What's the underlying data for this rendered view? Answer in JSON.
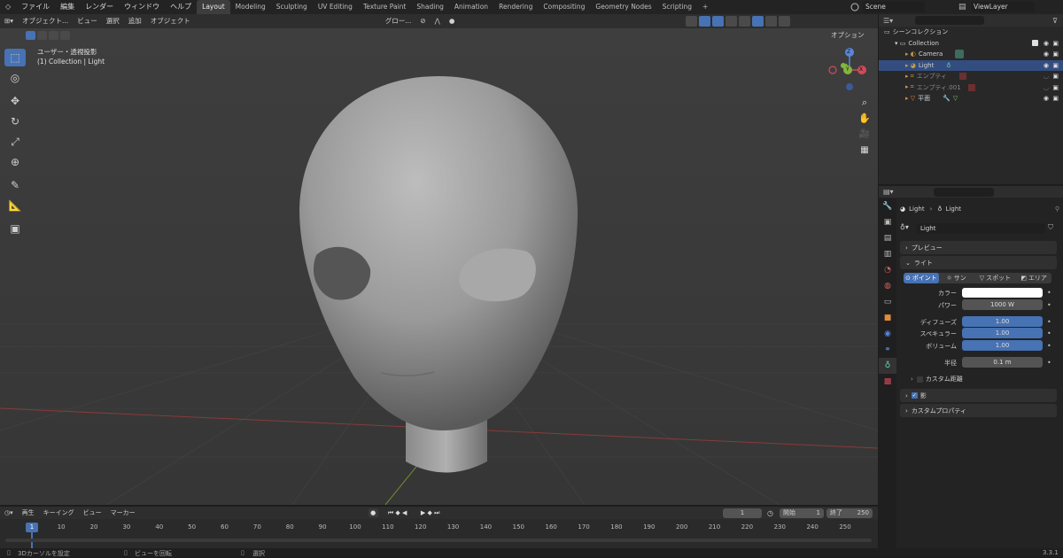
{
  "topbar": {
    "menus": [
      "ファイル",
      "編集",
      "レンダー",
      "ウィンドウ",
      "ヘルプ"
    ],
    "workspaces": [
      "Layout",
      "Modeling",
      "Sculpting",
      "UV Editing",
      "Texture Paint",
      "Shading",
      "Animation",
      "Rendering",
      "Compositing",
      "Geometry Nodes",
      "Scripting"
    ],
    "active_workspace": "Layout",
    "plus": "+",
    "scene": "Scene",
    "view_layer": "ViewLayer"
  },
  "viewport": {
    "mode": "オブジェクト...",
    "menus": [
      "ビュー",
      "選択",
      "追加",
      "オブジェクト"
    ],
    "transform_orientation": "グロー...",
    "view_name": "ユーザー・透視投影",
    "context": "(1) Collection | Light",
    "options": "オプション",
    "gizmo": {
      "z": "Z",
      "y": "Y",
      "x": "X"
    }
  },
  "outliner": {
    "title": "シーンコレクション",
    "items": [
      {
        "name": "Collection",
        "indent": 1,
        "selected": false
      },
      {
        "name": "Camera",
        "indent": 2,
        "selected": false
      },
      {
        "name": "Light",
        "indent": 2,
        "selected": true
      },
      {
        "name": "エンプティ",
        "indent": 2,
        "selected": false
      },
      {
        "name": "エンプティ.001",
        "indent": 2,
        "selected": false
      },
      {
        "name": "平面",
        "indent": 2,
        "selected": false
      }
    ]
  },
  "properties": {
    "breadcrumb": [
      "Light",
      "Light"
    ],
    "datablock": "Light",
    "panels": {
      "preview": "プレビュー",
      "light": "ライト",
      "custom_distance": "カスタム距離",
      "shadow": "影",
      "custom_props": "カスタムプロパティ"
    },
    "light_types": [
      "ポイント",
      "サン",
      "スポット",
      "エリア"
    ],
    "active_type": "ポイント",
    "fields": {
      "color_label": "カラー",
      "color": "#ffffff",
      "power_label": "パワー",
      "power": "1000 W",
      "diffuse_label": "ディフューズ",
      "diffuse": "1.00",
      "specular_label": "スペキュラー",
      "specular": "1.00",
      "volume_label": "ボリューム",
      "volume": "1.00",
      "radius_label": "半径",
      "radius": "0.1 m"
    }
  },
  "timeline": {
    "menus": [
      "再生",
      "キーイング",
      "ビュー",
      "マーカー"
    ],
    "current_frame": "1",
    "start_label": "開始",
    "start": "1",
    "end_label": "終了",
    "end": "250",
    "ticks": [
      "1",
      "10",
      "20",
      "30",
      "40",
      "50",
      "60",
      "70",
      "80",
      "90",
      "100",
      "110",
      "120",
      "130",
      "140",
      "150",
      "160",
      "170",
      "180",
      "190",
      "200",
      "210",
      "220",
      "230",
      "240",
      "250"
    ]
  },
  "statusbar": {
    "left": "3Dカーソルを設定",
    "middle": "ビューを回転",
    "right": "選択",
    "version": "3.3.1"
  }
}
